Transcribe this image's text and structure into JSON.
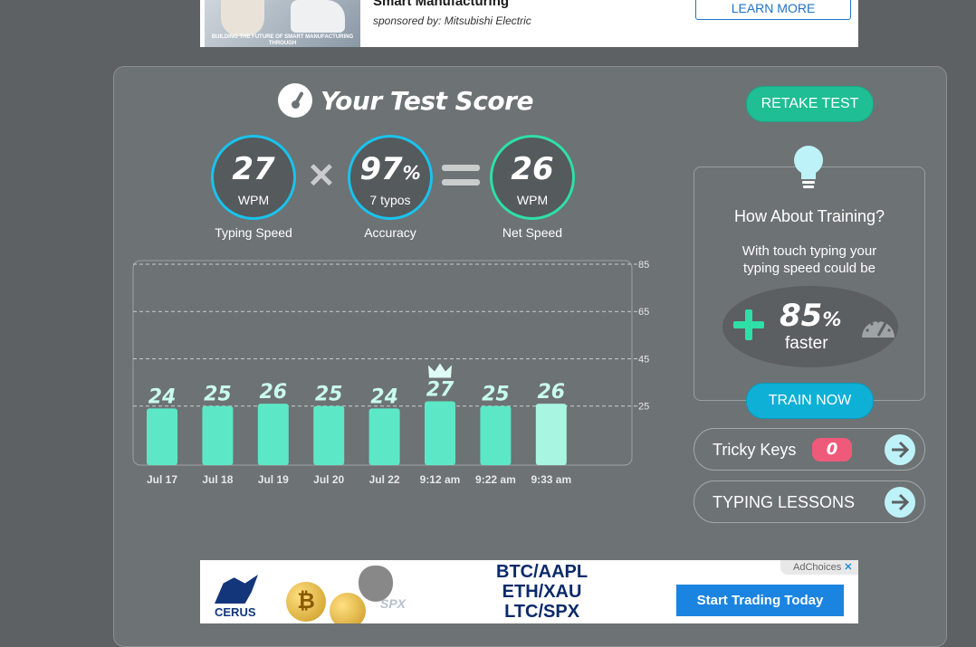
{
  "ad_top": {
    "headline": "Smart Manufacturing",
    "sponsor": "sponsored by: Mitsubishi Electric",
    "image_caption": "BUILDING THE FUTURE OF SMART MANUFACTURING THROUGH",
    "cta": "LEARN MORE"
  },
  "score": {
    "title": "Your Test Score",
    "retake_label": "RETAKE TEST",
    "typing_speed": {
      "value": "27",
      "unit": "WPM",
      "label": "Typing Speed"
    },
    "accuracy": {
      "value": "97",
      "unit_pct": "%",
      "sub": "7 typos",
      "label": "Accuracy"
    },
    "net_speed": {
      "value": "26",
      "unit": "WPM",
      "label": "Net Speed"
    },
    "times_symbol": "✕"
  },
  "chart_data": {
    "type": "bar",
    "categories": [
      "Jul 17",
      "Jul 18",
      "Jul 19",
      "Jul 20",
      "Jul 22",
      "9:12 am",
      "9:22 am",
      "9:33 am"
    ],
    "values": [
      24,
      25,
      26,
      25,
      24,
      27,
      25,
      26
    ],
    "best_index": 5,
    "current_index": 7,
    "yticks": [
      25,
      45,
      65,
      85
    ],
    "ylim": [
      0,
      85
    ],
    "grid": "dashed horizontal",
    "colors": {
      "bar": "#5ce8c7",
      "bar_current": "#a8f5e2",
      "label": "#c9fbef"
    }
  },
  "training": {
    "question": "How About Training?",
    "desc_line1": "With touch typing your",
    "desc_line2": "typing speed could be",
    "percent": "85",
    "percent_sign": "%",
    "faster": "faster",
    "cta": "TRAIN NOW"
  },
  "tricky_keys": {
    "label": "Tricky Keys",
    "count": "0"
  },
  "lessons": {
    "label": "TYPING LESSONS"
  },
  "ad_bottom": {
    "adchoices": "AdChoices",
    "brand": "CERUS",
    "spx_badge": "SPX",
    "pair1": "BTC/AAPL",
    "pair2": "ETH/XAU",
    "pair3": "LTC/SPX",
    "cta": "Start Trading Today"
  },
  "colors": {
    "background": "#5d6163",
    "panel": "#6d7274",
    "cyan": "#19c3ee",
    "green": "#2ee0a6",
    "retake": "#1fbe94",
    "train_now": "#0eb0d6",
    "badge": "#ef5a7a"
  }
}
